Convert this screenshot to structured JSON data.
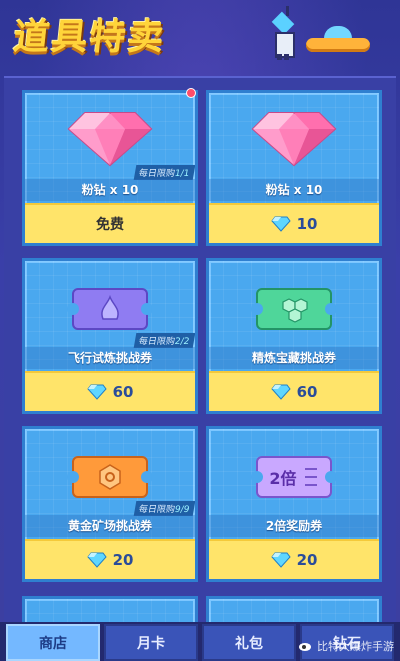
{
  "header": {
    "title": "道具特卖"
  },
  "items": [
    {
      "name": "粉钻 x 10",
      "limit_label": "每日限购",
      "limit_count": "1/1",
      "price_label": "免费",
      "price_value": "",
      "art": "pink-diamond"
    },
    {
      "name": "粉钻 x 10",
      "limit_label": "",
      "limit_count": "",
      "price_label": "",
      "price_value": "10",
      "art": "pink-diamond"
    },
    {
      "name": "飞行试炼挑战券",
      "limit_label": "每日限购",
      "limit_count": "2/2",
      "price_label": "",
      "price_value": "60",
      "art": "purple-ticket"
    },
    {
      "name": "精炼宝藏挑战券",
      "limit_label": "",
      "limit_count": "",
      "price_label": "",
      "price_value": "60",
      "art": "green-ticket"
    },
    {
      "name": "黄金矿场挑战券",
      "limit_label": "每日限购",
      "limit_count": "9/9",
      "price_label": "",
      "price_value": "20",
      "art": "orange-ticket"
    },
    {
      "name": "2倍奖励券",
      "limit_label": "",
      "limit_count": "",
      "price_label": "",
      "price_value": "20",
      "art": "double-reward-ticket"
    }
  ],
  "tabs": [
    {
      "label": "商店",
      "active": true
    },
    {
      "label": "月卡",
      "active": false
    },
    {
      "label": "礼包",
      "active": false
    },
    {
      "label": "钻石",
      "active": false
    }
  ],
  "watermark": {
    "text": "比特大爆炸手游"
  },
  "colors": {
    "title": "#ffd43a",
    "card": "#4aa8ef",
    "price_bar": "#ffe46a",
    "active_tab": "#74b8ff",
    "gem": "#5fd6ff"
  }
}
